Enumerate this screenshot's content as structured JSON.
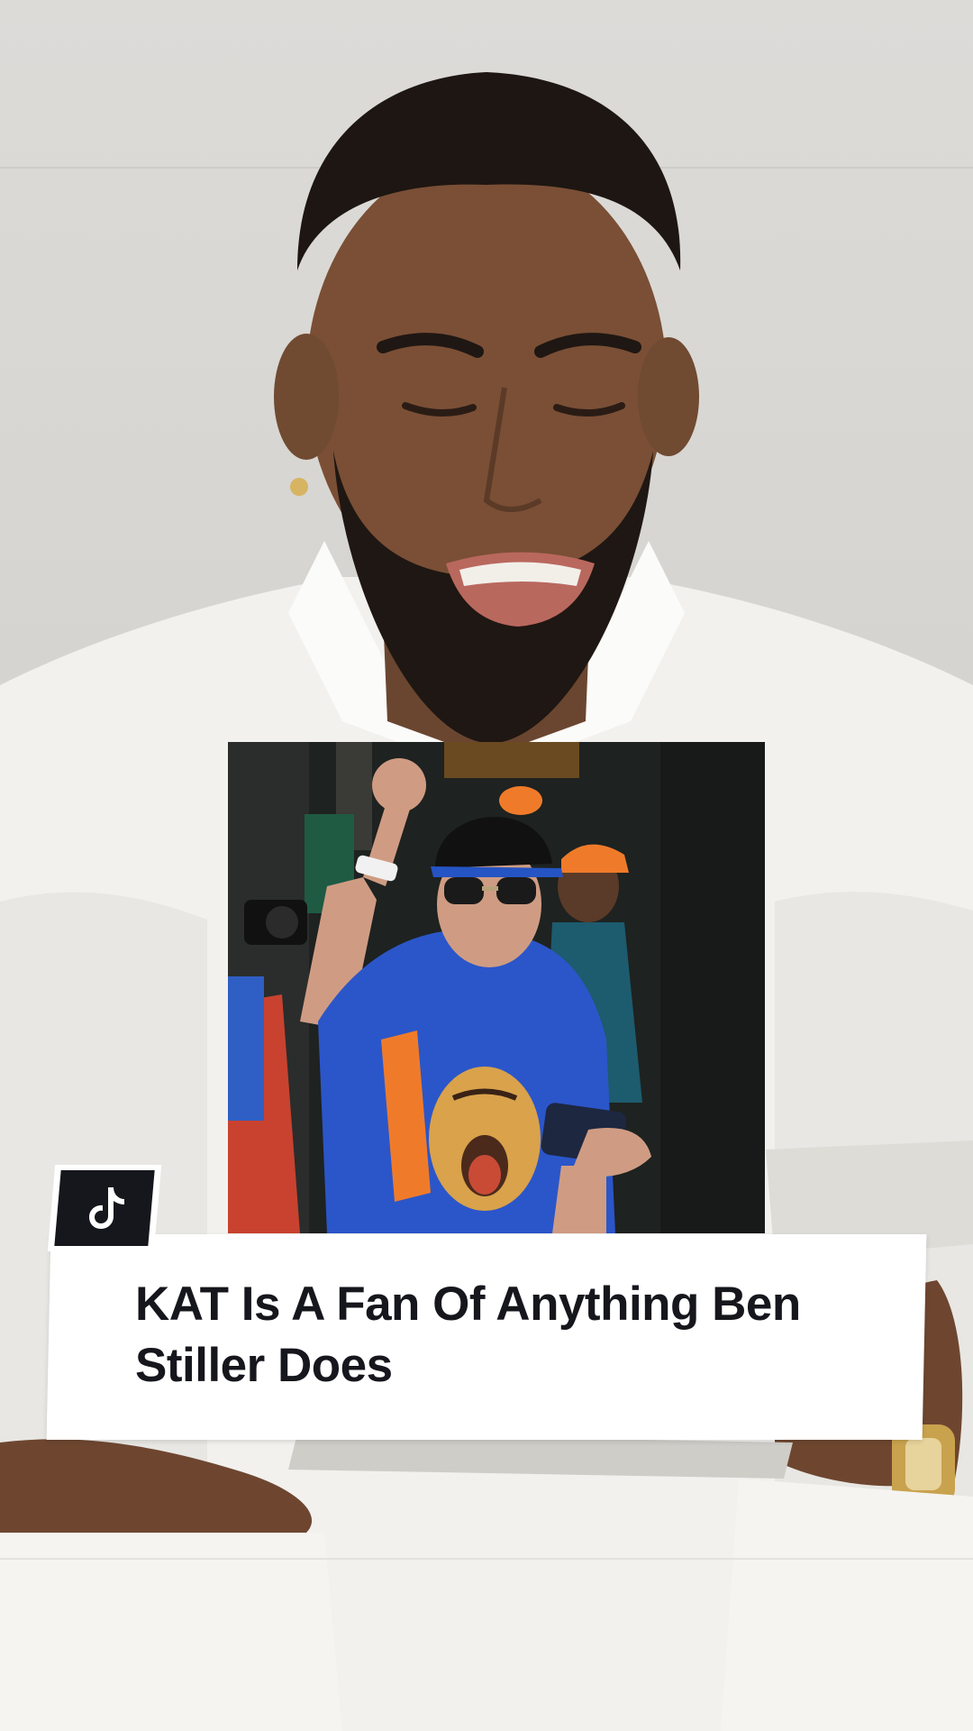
{
  "caption": {
    "title": "KAT Is A Fan Of Anything Ben Stiller Does"
  },
  "logo": {
    "icon": "tiktok-note-icon"
  },
  "colors": {
    "caption_text": "#16161d",
    "caption_bg": "#ffffff",
    "logo_bg": "#16161d",
    "shirt_blue": "#2b56c9",
    "cap_orange": "#ef7b2a"
  }
}
